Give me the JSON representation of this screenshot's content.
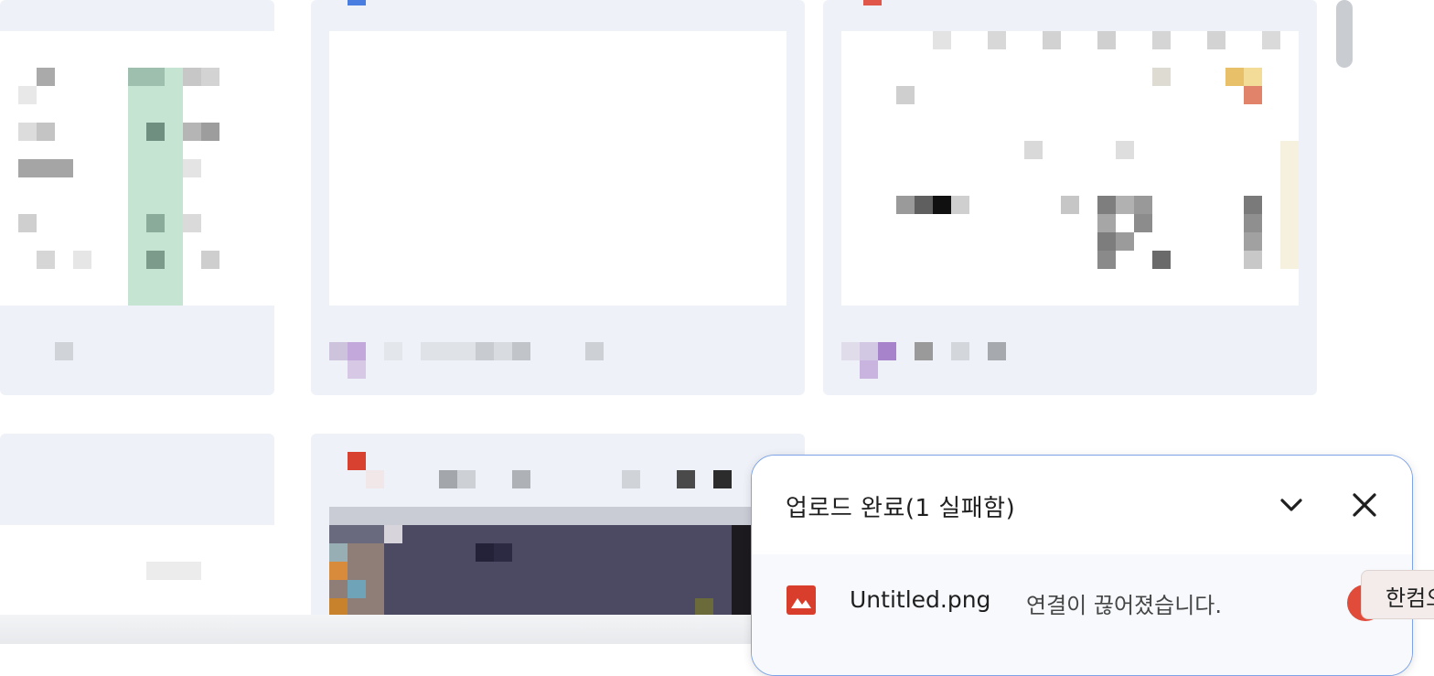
{
  "upload_panel": {
    "title": "업로드 완료(1 실패함)",
    "collapse_icon": "chevron-down-icon",
    "close_icon": "close-icon",
    "items": [
      {
        "file_name": "Untitled.png",
        "status": "연결이 끊어졌습니다.",
        "icon": "image-file-icon"
      }
    ]
  },
  "tooltip": {
    "text": "한컴오"
  },
  "colors": {
    "accent_border": "#7ea3e6",
    "image_icon": "#d93d2b",
    "error": "#e04b3a"
  }
}
